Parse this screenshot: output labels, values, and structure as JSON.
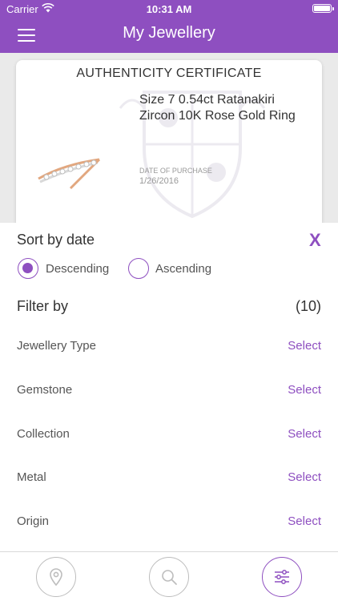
{
  "status_bar": {
    "carrier": "Carrier",
    "time": "10:31 AM"
  },
  "header": {
    "title": "My Jewellery"
  },
  "card": {
    "certificate_title": "AUTHENTICITY CERTIFICATE",
    "product_name": "Size 7 0.54ct Ratanakiri Zircon 10K Rose Gold Ring",
    "purchase_label": "DATE OF PURCHASE",
    "purchase_date": "1/26/2016"
  },
  "sort": {
    "title": "Sort by date",
    "close_label": "X",
    "options": [
      {
        "label": "Descending",
        "selected": true
      },
      {
        "label": "Ascending",
        "selected": false
      }
    ]
  },
  "filter": {
    "title": "Filter by",
    "count": "(10)",
    "rows": [
      {
        "label": "Jewellery Type",
        "action": "Select"
      },
      {
        "label": "Gemstone",
        "action": "Select"
      },
      {
        "label": "Collection",
        "action": "Select"
      },
      {
        "label": "Metal",
        "action": "Select"
      },
      {
        "label": "Origin",
        "action": "Select"
      }
    ]
  },
  "tabbar": {
    "tabs": [
      {
        "icon": "location-pin-icon",
        "active": false
      },
      {
        "icon": "search-icon",
        "active": false
      },
      {
        "icon": "filter-sliders-icon",
        "active": true
      }
    ]
  },
  "colors": {
    "accent": "#8e4fc0",
    "background": "#eaeaea"
  }
}
